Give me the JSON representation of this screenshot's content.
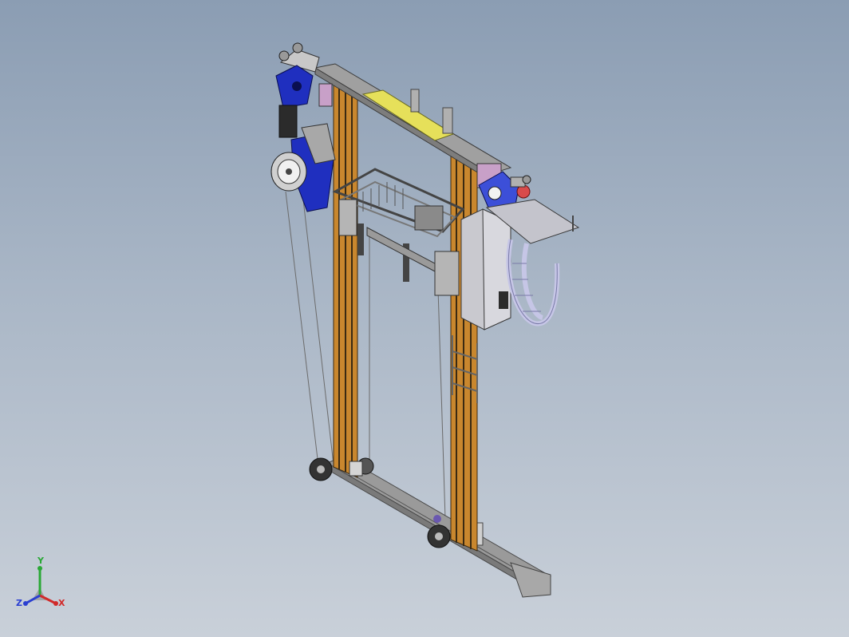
{
  "triad": {
    "x_label": "X",
    "y_label": "Y",
    "z_label": "Z",
    "x_color": "#d12a2a",
    "y_color": "#2aa836",
    "z_color": "#2a3fd1"
  },
  "colors": {
    "frame_gray": "#8e8e8e",
    "column_orange": "#c9872e",
    "motor_blue": "#1f2fbf",
    "highlight_yellow": "#e6e05a",
    "cabinet_gray": "#c9c9cf",
    "cable_lavender": "#d9d9f0"
  }
}
